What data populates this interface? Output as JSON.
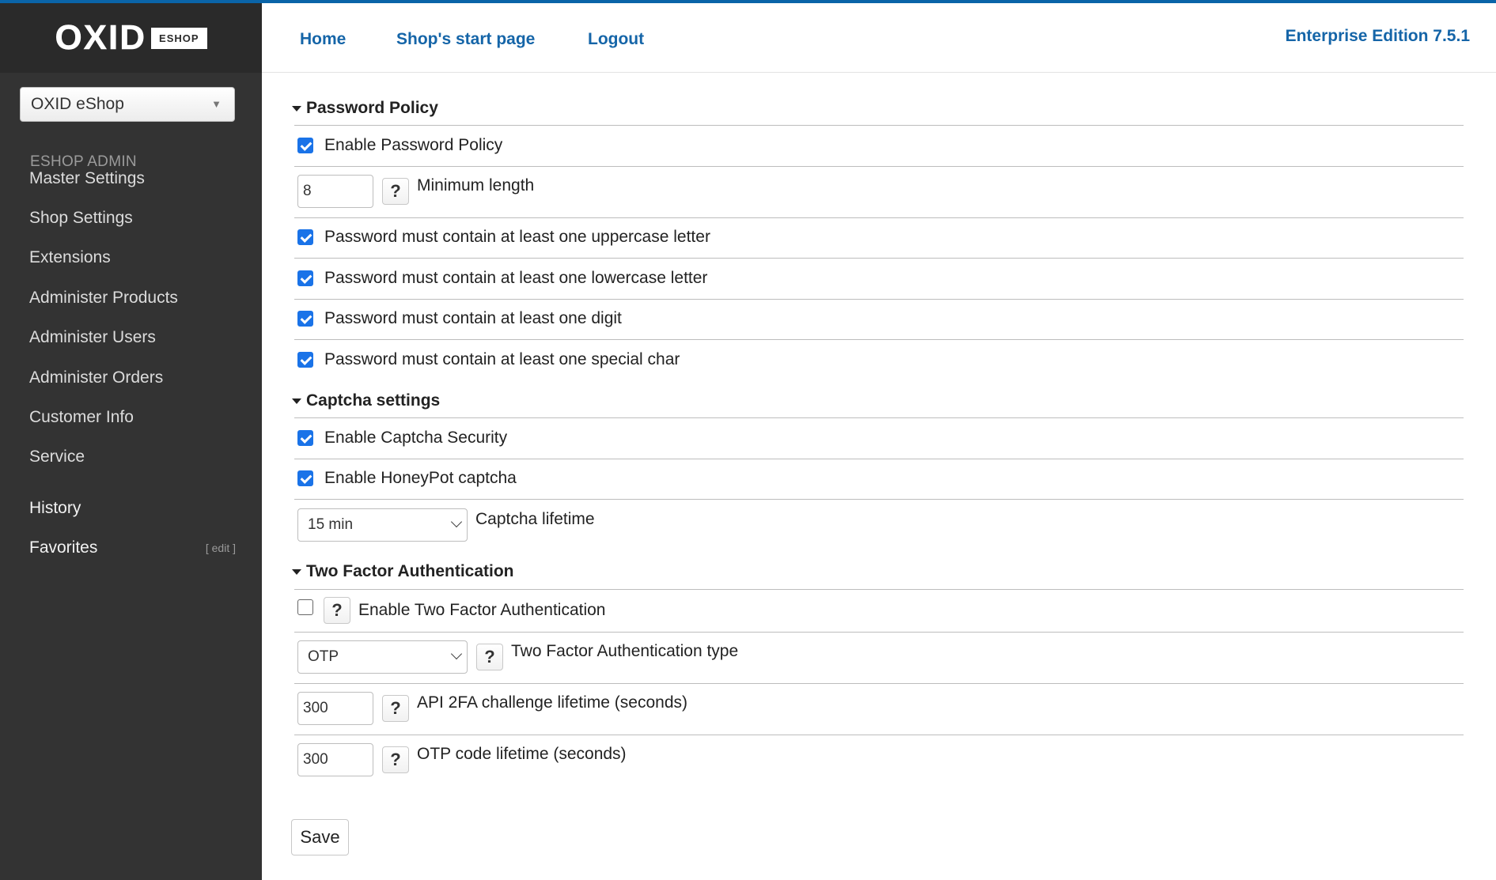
{
  "logo": {
    "word": "OXID",
    "badge": "ESHOP"
  },
  "sidebar": {
    "shop_select": "OXID eShop",
    "heading": "ESHOP ADMIN",
    "items": [
      "Master Settings",
      "Shop Settings",
      "Extensions",
      "Administer Products",
      "Administer Users",
      "Administer Orders",
      "Customer Info",
      "Service"
    ],
    "history": "History",
    "favorites": "Favorites",
    "favorites_edit": "[ edit ]"
  },
  "header": {
    "links": [
      "Home",
      "Shop's start page",
      "Logout"
    ],
    "edition": "Enterprise Edition 7.5.1"
  },
  "password_policy": {
    "title": "Password Policy",
    "enable_label": "Enable Password Policy",
    "enable_checked": true,
    "min_length_value": "8",
    "min_length_label": "Minimum length",
    "uppercase_label": "Password must contain at least one uppercase letter",
    "uppercase_checked": true,
    "lowercase_label": "Password must contain at least one lowercase letter",
    "lowercase_checked": true,
    "digit_label": "Password must contain at least one digit",
    "digit_checked": true,
    "special_label": "Password must contain at least one special char",
    "special_checked": true
  },
  "captcha": {
    "title": "Captcha settings",
    "enable_label": "Enable Captcha Security",
    "enable_checked": true,
    "honeypot_label": "Enable HoneyPot captcha",
    "honeypot_checked": true,
    "lifetime_value": "15 min",
    "lifetime_label": "Captcha lifetime"
  },
  "two_factor": {
    "title": "Two Factor Authentication",
    "enable_label": "Enable Two Factor Authentication",
    "enable_checked": false,
    "type_value": "OTP",
    "type_label": "Two Factor Authentication type",
    "api_value": "300",
    "api_label": "API 2FA challenge lifetime (seconds)",
    "otp_value": "300",
    "otp_label": "OTP code lifetime (seconds)"
  },
  "help_glyph": "?",
  "save_label": "Save",
  "colors": {
    "accent": "#1565a8",
    "sidebar": "#333333",
    "checkbox": "#1a73e8"
  }
}
